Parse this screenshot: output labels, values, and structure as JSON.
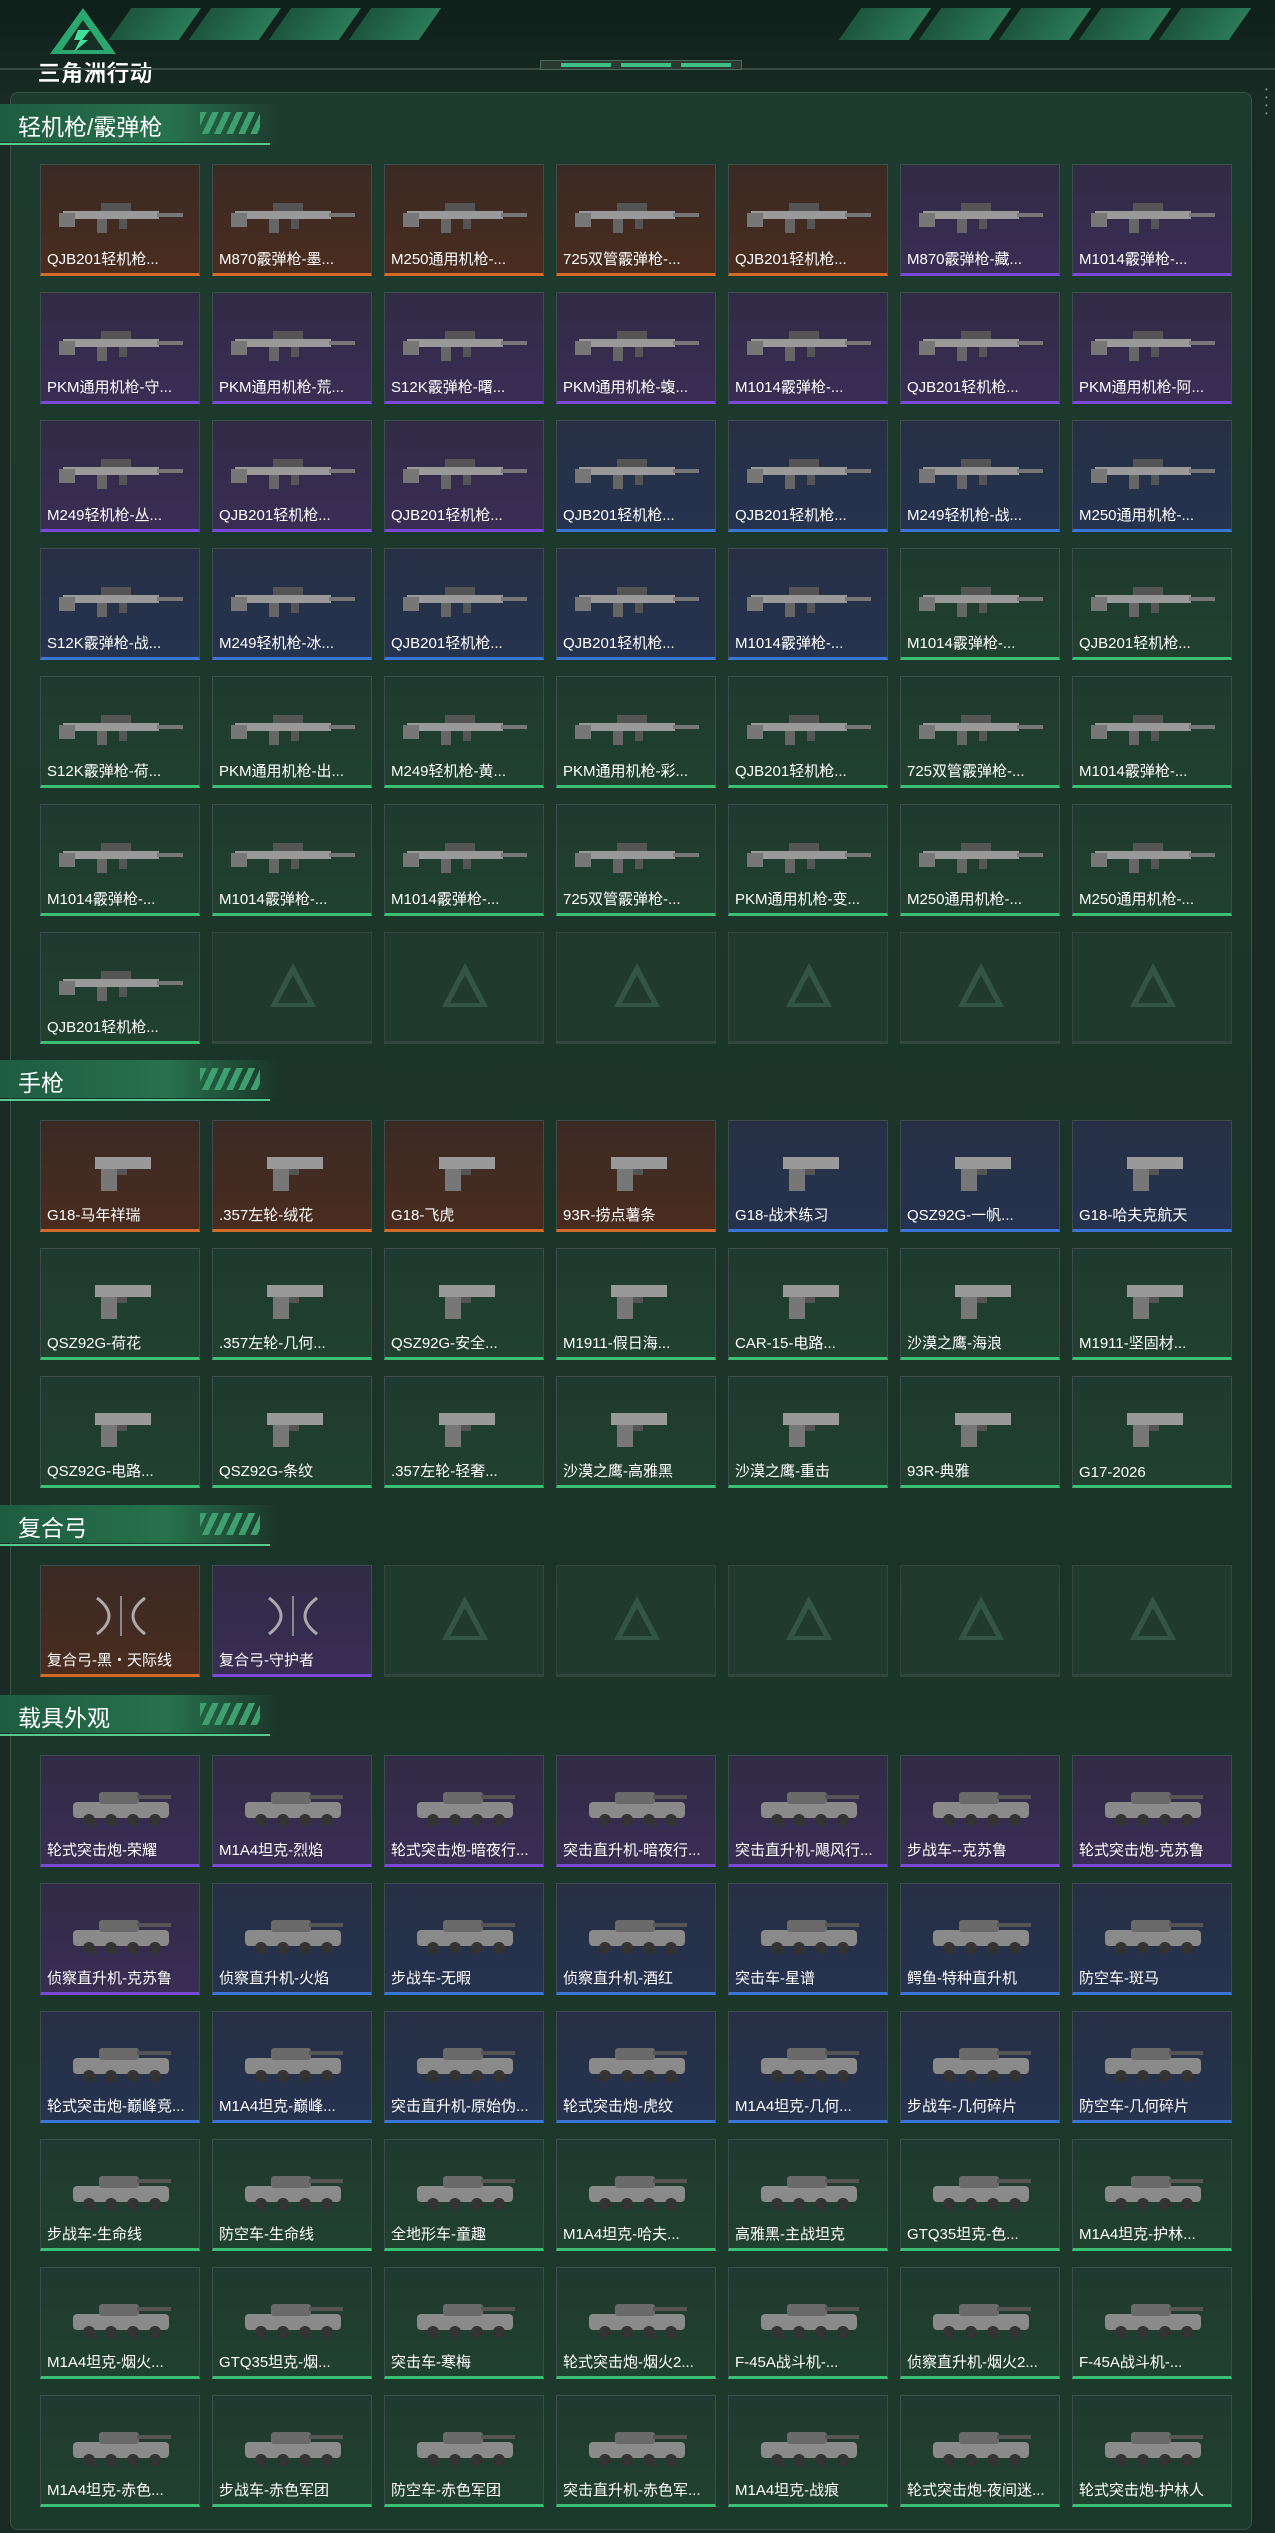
{
  "header": {
    "brand": "三角洲行动"
  },
  "colors": {
    "orange": "#d46a2a",
    "purple": "#7a49d8",
    "blue": "#3a74d8",
    "green": "#3bbf72",
    "empty": "#7a8a85"
  },
  "sections": [
    {
      "title": "轻机枪/霰弹枪",
      "icon": "rifle-icon",
      "items": [
        {
          "label": "QJB201轻机枪...",
          "rarity": "orange"
        },
        {
          "label": "M870霰弹枪-墨...",
          "rarity": "orange"
        },
        {
          "label": "M250通用机枪-...",
          "rarity": "orange"
        },
        {
          "label": "725双管霰弹枪-...",
          "rarity": "orange"
        },
        {
          "label": "QJB201轻机枪...",
          "rarity": "orange"
        },
        {
          "label": "M870霰弹枪-藏...",
          "rarity": "purple"
        },
        {
          "label": "M1014霰弹枪-...",
          "rarity": "purple"
        },
        {
          "label": "PKM通用机枪-守...",
          "rarity": "purple"
        },
        {
          "label": "PKM通用机枪-荒...",
          "rarity": "purple"
        },
        {
          "label": "S12K霰弹枪-曙...",
          "rarity": "purple"
        },
        {
          "label": "PKM通用机枪-蝮...",
          "rarity": "purple"
        },
        {
          "label": "M1014霰弹枪-...",
          "rarity": "purple"
        },
        {
          "label": "QJB201轻机枪...",
          "rarity": "purple"
        },
        {
          "label": "PKM通用机枪-阿...",
          "rarity": "purple"
        },
        {
          "label": "M249轻机枪-丛...",
          "rarity": "purple"
        },
        {
          "label": "QJB201轻机枪...",
          "rarity": "purple"
        },
        {
          "label": "QJB201轻机枪...",
          "rarity": "purple"
        },
        {
          "label": "QJB201轻机枪...",
          "rarity": "blue"
        },
        {
          "label": "QJB201轻机枪...",
          "rarity": "blue"
        },
        {
          "label": "M249轻机枪-战...",
          "rarity": "blue"
        },
        {
          "label": "M250通用机枪-...",
          "rarity": "blue"
        },
        {
          "label": "S12K霰弹枪-战...",
          "rarity": "blue"
        },
        {
          "label": "M249轻机枪-冰...",
          "rarity": "blue"
        },
        {
          "label": "QJB201轻机枪...",
          "rarity": "blue"
        },
        {
          "label": "QJB201轻机枪...",
          "rarity": "blue"
        },
        {
          "label": "M1014霰弹枪-...",
          "rarity": "blue"
        },
        {
          "label": "M1014霰弹枪-...",
          "rarity": "green"
        },
        {
          "label": "QJB201轻机枪...",
          "rarity": "green"
        },
        {
          "label": "S12K霰弹枪-荷...",
          "rarity": "green"
        },
        {
          "label": "PKM通用机枪-出...",
          "rarity": "green"
        },
        {
          "label": "M249轻机枪-黄...",
          "rarity": "green"
        },
        {
          "label": "PKM通用机枪-彩...",
          "rarity": "green"
        },
        {
          "label": "QJB201轻机枪...",
          "rarity": "green"
        },
        {
          "label": "725双管霰弹枪-...",
          "rarity": "green"
        },
        {
          "label": "M1014霰弹枪-...",
          "rarity": "green"
        },
        {
          "label": "M1014霰弹枪-...",
          "rarity": "green"
        },
        {
          "label": "M1014霰弹枪-...",
          "rarity": "green"
        },
        {
          "label": "M1014霰弹枪-...",
          "rarity": "green"
        },
        {
          "label": "725双管霰弹枪-...",
          "rarity": "green"
        },
        {
          "label": "PKM通用机枪-变...",
          "rarity": "green"
        },
        {
          "label": "M250通用机枪-...",
          "rarity": "green"
        },
        {
          "label": "M250通用机枪-...",
          "rarity": "green"
        },
        {
          "label": "QJB201轻机枪...",
          "rarity": "green"
        },
        {
          "label": "",
          "rarity": "empty"
        },
        {
          "label": "",
          "rarity": "empty"
        },
        {
          "label": "",
          "rarity": "empty"
        },
        {
          "label": "",
          "rarity": "empty"
        },
        {
          "label": "",
          "rarity": "empty"
        },
        {
          "label": "",
          "rarity": "empty"
        }
      ]
    },
    {
      "title": "手枪",
      "icon": "pistol-icon",
      "items": [
        {
          "label": "G18-马年祥瑞",
          "rarity": "orange"
        },
        {
          "label": ".357左轮-绒花",
          "rarity": "orange"
        },
        {
          "label": "G18-飞虎",
          "rarity": "orange"
        },
        {
          "label": "93R-捞点薯条",
          "rarity": "orange"
        },
        {
          "label": "G18-战术练习",
          "rarity": "blue"
        },
        {
          "label": "QSZ92G-一帆...",
          "rarity": "blue"
        },
        {
          "label": "G18-哈夫克航天",
          "rarity": "blue"
        },
        {
          "label": "QSZ92G-荷花",
          "rarity": "green"
        },
        {
          "label": ".357左轮-几何...",
          "rarity": "green"
        },
        {
          "label": "QSZ92G-安全...",
          "rarity": "green"
        },
        {
          "label": "M1911-假日海...",
          "rarity": "green"
        },
        {
          "label": "CAR-15-电路...",
          "rarity": "green"
        },
        {
          "label": "沙漠之鹰-海浪",
          "rarity": "green"
        },
        {
          "label": "M1911-坚固材...",
          "rarity": "green"
        },
        {
          "label": "QSZ92G-电路...",
          "rarity": "green"
        },
        {
          "label": "QSZ92G-条纹",
          "rarity": "green"
        },
        {
          "label": ".357左轮-轻奢...",
          "rarity": "green"
        },
        {
          "label": "沙漠之鹰-高雅黑",
          "rarity": "green"
        },
        {
          "label": "沙漠之鹰-重击",
          "rarity": "green"
        },
        {
          "label": "93R-典雅",
          "rarity": "green"
        },
        {
          "label": "G17-2026",
          "rarity": "green"
        }
      ]
    },
    {
      "title": "复合弓",
      "icon": "bow-icon",
      "items": [
        {
          "label": "复合弓-黑・天际线",
          "rarity": "orange"
        },
        {
          "label": "复合弓-守护者",
          "rarity": "purple"
        },
        {
          "label": "",
          "rarity": "empty"
        },
        {
          "label": "",
          "rarity": "empty"
        },
        {
          "label": "",
          "rarity": "empty"
        },
        {
          "label": "",
          "rarity": "empty"
        },
        {
          "label": "",
          "rarity": "empty"
        }
      ]
    },
    {
      "title": "载具外观",
      "icon": "vehicle-icon",
      "items": [
        {
          "label": "轮式突击炮-荣耀",
          "rarity": "purple"
        },
        {
          "label": "M1A4坦克-烈焰",
          "rarity": "purple"
        },
        {
          "label": "轮式突击炮-暗夜行...",
          "rarity": "purple"
        },
        {
          "label": "突击直升机-暗夜行...",
          "rarity": "purple"
        },
        {
          "label": "突击直升机-飓风行...",
          "rarity": "purple"
        },
        {
          "label": "步战车--克苏鲁",
          "rarity": "purple"
        },
        {
          "label": "轮式突击炮-克苏鲁",
          "rarity": "purple"
        },
        {
          "label": "侦察直升机-克苏鲁",
          "rarity": "purple"
        },
        {
          "label": "侦察直升机-火焰",
          "rarity": "blue"
        },
        {
          "label": "步战车-无暇",
          "rarity": "blue"
        },
        {
          "label": "侦察直升机-酒红",
          "rarity": "blue"
        },
        {
          "label": "突击车-星谱",
          "rarity": "blue"
        },
        {
          "label": "鳄鱼-特种直升机",
          "rarity": "blue"
        },
        {
          "label": "防空车-斑马",
          "rarity": "blue"
        },
        {
          "label": "轮式突击炮-巅峰竞...",
          "rarity": "blue"
        },
        {
          "label": "M1A4坦克-巅峰...",
          "rarity": "blue"
        },
        {
          "label": "突击直升机-原始伪...",
          "rarity": "blue"
        },
        {
          "label": "轮式突击炮-虎纹",
          "rarity": "blue"
        },
        {
          "label": "M1A4坦克-几何...",
          "rarity": "blue"
        },
        {
          "label": "步战车-几何碎片",
          "rarity": "blue"
        },
        {
          "label": "防空车-几何碎片",
          "rarity": "blue"
        },
        {
          "label": "步战车-生命线",
          "rarity": "green"
        },
        {
          "label": "防空车-生命线",
          "rarity": "green"
        },
        {
          "label": "全地形车-童趣",
          "rarity": "green"
        },
        {
          "label": "M1A4坦克-哈夫...",
          "rarity": "green"
        },
        {
          "label": "高雅黑-主战坦克",
          "rarity": "green"
        },
        {
          "label": "GTQ35坦克-色...",
          "rarity": "green"
        },
        {
          "label": "M1A4坦克-护林...",
          "rarity": "green"
        },
        {
          "label": "M1A4坦克-烟火...",
          "rarity": "green"
        },
        {
          "label": "GTQ35坦克-烟...",
          "rarity": "green"
        },
        {
          "label": "突击车-寒梅",
          "rarity": "green"
        },
        {
          "label": "轮式突击炮-烟火2...",
          "rarity": "green"
        },
        {
          "label": "F-45A战斗机-...",
          "rarity": "green"
        },
        {
          "label": "侦察直升机-烟火2...",
          "rarity": "green"
        },
        {
          "label": "F-45A战斗机-...",
          "rarity": "green"
        },
        {
          "label": "M1A4坦克-赤色...",
          "rarity": "green"
        },
        {
          "label": "步战车-赤色军团",
          "rarity": "green"
        },
        {
          "label": "防空车-赤色军团",
          "rarity": "green"
        },
        {
          "label": "突击直升机-赤色军...",
          "rarity": "green"
        },
        {
          "label": "M1A4坦克-战痕",
          "rarity": "green"
        },
        {
          "label": "轮式突击炮-夜间迷...",
          "rarity": "green"
        },
        {
          "label": "轮式突击炮-护林人",
          "rarity": "green"
        }
      ]
    }
  ]
}
